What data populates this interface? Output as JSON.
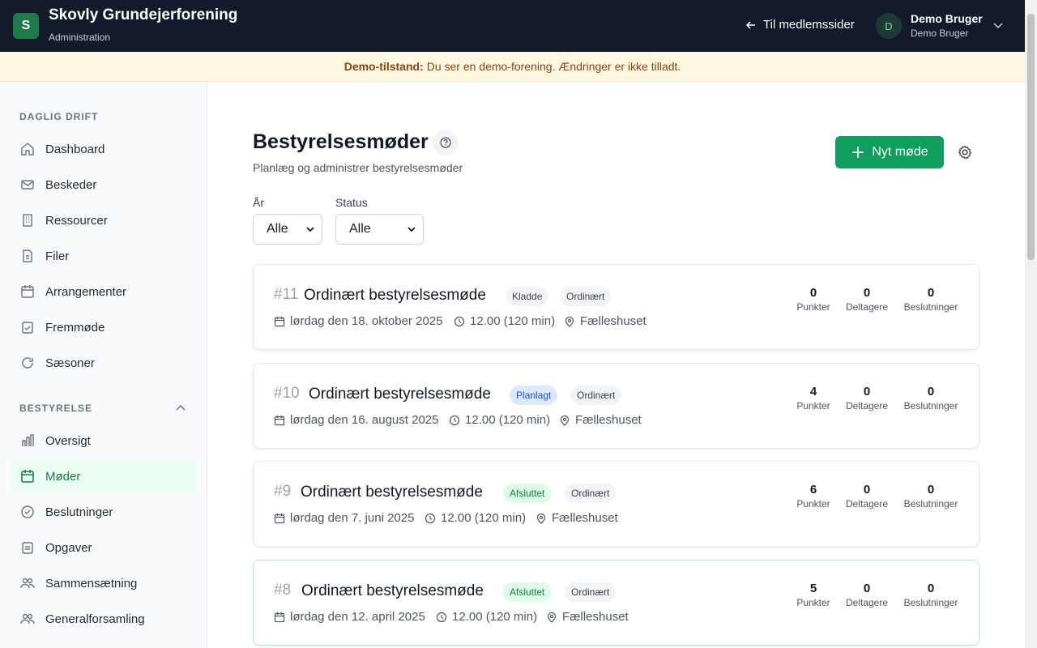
{
  "header": {
    "logo_letter": "S",
    "title": "Skovly Grundejerforening",
    "subtitle": "Administration",
    "back_link": "Til medlemssider",
    "user_initial": "D",
    "user_name": "Demo Bruger",
    "user_sub": "Demo Bruger"
  },
  "banner": {
    "label": "Demo-tilstand:",
    "text": "Du ser en demo-forening. Ændringer er ikke tilladt."
  },
  "sidebar": {
    "section1": "DAGLIG DRIFT",
    "items1": [
      {
        "label": "Dashboard",
        "icon": "home-icon"
      },
      {
        "label": "Beskeder",
        "icon": "mail-icon"
      },
      {
        "label": "Ressourcer",
        "icon": "building-icon"
      },
      {
        "label": "Filer",
        "icon": "file-icon"
      },
      {
        "label": "Arrangementer",
        "icon": "calendar-icon"
      },
      {
        "label": "Fremmøde",
        "icon": "clipboard-check-icon"
      },
      {
        "label": "Sæsoner",
        "icon": "refresh-icon"
      }
    ],
    "section2": "BESTYRELSE",
    "items2": [
      {
        "label": "Oversigt",
        "icon": "bar-chart-icon"
      },
      {
        "label": "Møder",
        "icon": "calendar-icon",
        "active": true
      },
      {
        "label": "Beslutninger",
        "icon": "check-circle-icon"
      },
      {
        "label": "Opgaver",
        "icon": "clipboard-icon"
      },
      {
        "label": "Sammensætning",
        "icon": "users-icon"
      },
      {
        "label": "Generalforsamling",
        "icon": "users-icon"
      }
    ]
  },
  "main": {
    "title": "Bestyrelsesmøder",
    "subtitle": "Planlæg og administrer bestyrelsesmøder",
    "new_button": "Nyt møde",
    "filters": {
      "year_label": "År",
      "year_value": "Alle",
      "status_label": "Status",
      "status_value": "Alle"
    },
    "stat_labels": [
      "Punkter",
      "Deltagere",
      "Beslutninger"
    ],
    "meetings": [
      {
        "num": "#11",
        "title": "Ordinært bestyrelsesmøde",
        "status": "Kladde",
        "type": "Ordinært",
        "date": "lørdag den 18. oktober 2025",
        "time": "12.00 (120 min)",
        "place": "Fælleshuset",
        "points": "0",
        "participants": "0",
        "decisions": "0"
      },
      {
        "num": "#10",
        "title": "Ordinært bestyrelsesmøde",
        "status": "Planlagt",
        "type": "Ordinært",
        "date": "lørdag den 16. august 2025",
        "time": "12.00 (120 min)",
        "place": "Fælleshuset",
        "points": "4",
        "participants": "0",
        "decisions": "0"
      },
      {
        "num": "#9",
        "title": "Ordinært bestyrelsesmøde",
        "status": "Afsluttet",
        "type": "Ordinært",
        "date": "lørdag den 7. juni 2025",
        "time": "12.00 (120 min)",
        "place": "Fælleshuset",
        "points": "6",
        "participants": "0",
        "decisions": "0"
      },
      {
        "num": "#8",
        "title": "Ordinært bestyrelsesmøde",
        "status": "Afsluttet",
        "type": "Ordinært",
        "date": "lørdag den 12. april 2025",
        "time": "12.00 (120 min)",
        "place": "Fælleshuset",
        "points": "5",
        "participants": "0",
        "decisions": "0"
      }
    ]
  },
  "colors": {
    "accent": "#0e9f5f",
    "topbar": "#121a2b",
    "kladde_bg": "#f3f4f6",
    "planlagt_bg": "#dbeafe",
    "afsluttet_bg": "#dcfce7"
  }
}
